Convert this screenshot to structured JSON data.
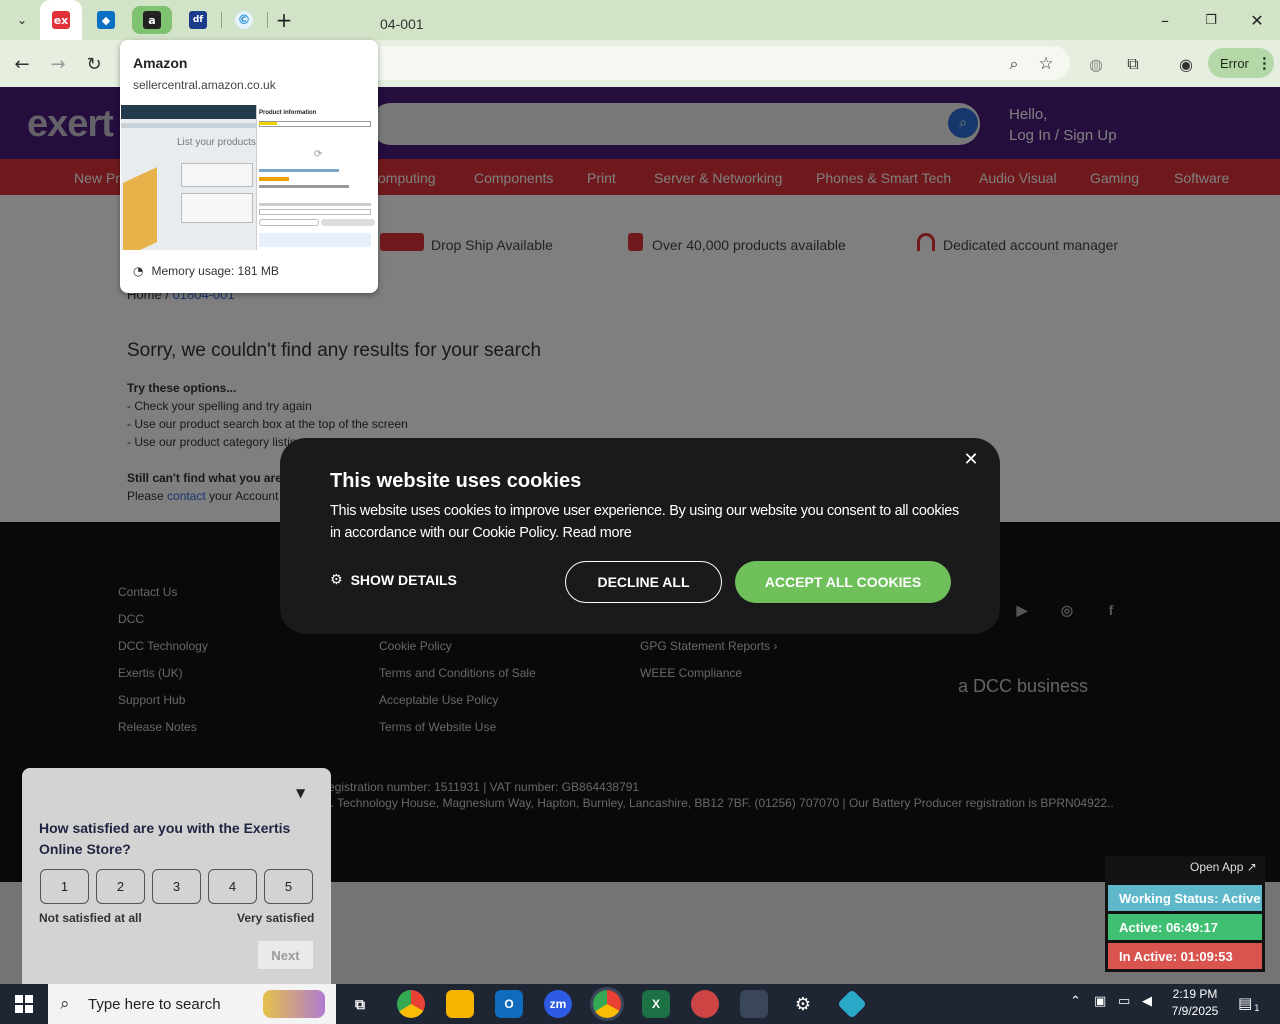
{
  "browser": {
    "tabs": [
      {
        "favicon": "ex",
        "color": "#e1323a"
      },
      {
        "favicon": "tool",
        "color": "#0a6fc2"
      },
      {
        "favicon": "a",
        "color": "#222222"
      },
      {
        "favicon": "df",
        "color": "#1b3a8a"
      },
      {
        "favicon": "©",
        "color": "#2a8fd6"
      }
    ],
    "new_tab": "+",
    "address_fragment": "04-001",
    "profile_status": "Error"
  },
  "hover_card": {
    "title": "Amazon",
    "url": "sellercentral.amazon.co.uk",
    "preview_heading": "Product information",
    "preview_side": "List your products",
    "memory": "Memory usage: 181 MB"
  },
  "site": {
    "logo": "exert",
    "hello": "Hello,",
    "login": "Log In / Sign Up",
    "nav": [
      "New Pro",
      "omputing",
      "Components",
      "Print",
      "Server & Networking",
      "Phones & Smart Tech",
      "Audio Visual",
      "Gaming",
      "Software"
    ],
    "usps": [
      "Drop Ship Available",
      "Over 40,000 products available",
      "Dedicated account manager"
    ],
    "breadcrumb_home": "Home",
    "breadcrumb_sep": "/",
    "breadcrumb_current": "01804-001",
    "no_results": "Sorry, we couldn't find any results for your search",
    "tips_heading": "Try these options...",
    "tips": [
      "- Check your spelling and try again",
      "- Use our product search box at the top of the screen",
      "- Use our product category listin"
    ],
    "still_cant": "Still can't find what you are lo",
    "please": "Please ",
    "contact": "contact",
    "please_end": " your Account M"
  },
  "footer": {
    "col1": [
      "Contact Us",
      "DCC",
      "DCC Technology",
      "Exertis (UK)",
      "Support Hub",
      "Release Notes"
    ],
    "col2": [
      "Cookie Policy",
      "Terms and Conditions of Sale",
      "Acceptable Use Policy",
      "Terms of Website Use"
    ],
    "col3": [
      "GPG Statement Reports",
      "WEEE Compliance"
    ],
    "dcc_tagline": "a DCC business",
    "reg_line1": "egistration number: 1511931 | VAT number: GB864438791",
    "reg_line2": "l. Technology House, Magnesium Way, Hapton, Burnley, Lancashire, BB12 7BF. (01256) 707070 | Our Battery Producer registration is BPRN04922.."
  },
  "cookie": {
    "title": "This website uses cookies",
    "body": "This website uses cookies to improve user experience. By using our website you consent to all cookies in accordance with our Cookie Policy.",
    "read_more": "Read more",
    "show_details": "SHOW DETAILS",
    "decline": "DECLINE ALL",
    "accept": "ACCEPT ALL COOKIES"
  },
  "survey": {
    "question": "How satisfied are you with the Exertis Online Store?",
    "ratings": [
      "1",
      "2",
      "3",
      "4",
      "5"
    ],
    "low_label": "Not satisfied at all",
    "high_label": "Very satisfied",
    "next": "Next"
  },
  "timer": {
    "open_app": "Open App ↗",
    "status": "Working Status: Active",
    "active": "Active: 06:49:17",
    "inactive": "In Active: 01:09:53",
    "colors": {
      "status": "#5fb8c9",
      "active": "#3fbf72",
      "inactive": "#d9534f"
    }
  },
  "taskbar": {
    "search_placeholder": "Type here to search",
    "time": "2:19 PM",
    "date": "7/9/2025",
    "notifications": "1"
  }
}
